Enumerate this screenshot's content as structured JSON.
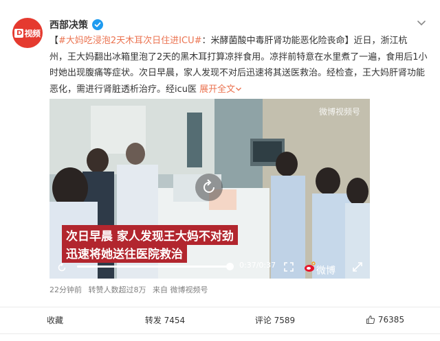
{
  "author": {
    "name": "西部决策",
    "avatar_text": "视频",
    "avatar_letter": "D"
  },
  "post": {
    "open_bracket": "【",
    "topic": "#大妈吃浸泡2天木耳次日住进ICU#",
    "headline": "：米酵菌酸中毒肝肾功能恶化险丧命】",
    "body_line1": "近日，浙江杭",
    "body_line2": "州，王大妈翻出冰箱里泡了2天的黑木耳打算凉拌食用。凉拌前特意在水里煮了一遍，食用后1小",
    "body_line3": "时她出现腹痛等症状。次日早晨，家人发现不对后迅速将其送医救治。经检查，王大妈肝肾功能",
    "body_line4": "恶化，需进行肾脏透析治疗。经icu医",
    "expand": "展开全文"
  },
  "video": {
    "subtitle_line1": "次日早晨 家人发现王大妈不对劲",
    "subtitle_line2": "迅速将她送往医院救治",
    "time": "0:37/0:37",
    "progress_percent": 100,
    "watermark_top": "微博视频号",
    "watermark_bottom": "微博"
  },
  "meta": {
    "time_ago": "22分钟前",
    "reposts_info": "转赞人数超过8万",
    "source": "来自 微博视频号"
  },
  "actions": {
    "favorite": "收藏",
    "repost": "转发 7454",
    "comment": "评论 7589",
    "like": "76385"
  },
  "colors": {
    "topic": "#eb7350",
    "verified": "#1e9bf0",
    "avatar_bg": "#e53a2f",
    "subtitle_bg": "#b2262e"
  }
}
